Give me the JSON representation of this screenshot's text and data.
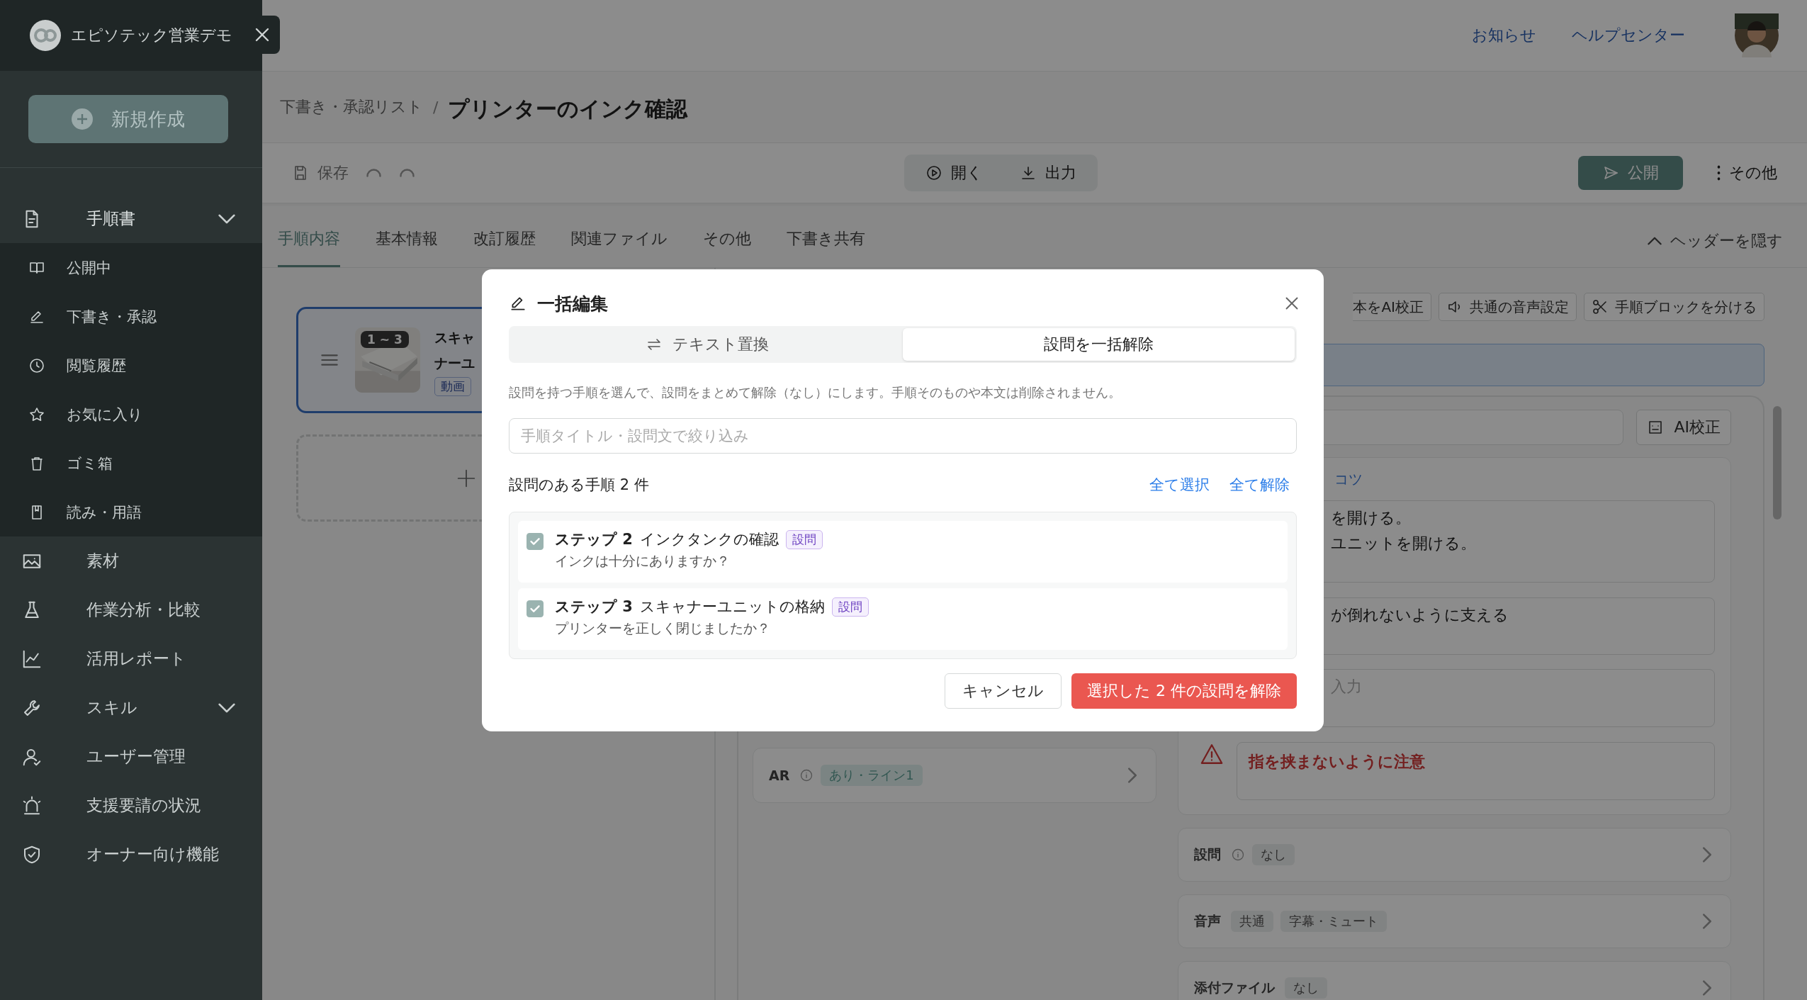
{
  "sidebar": {
    "workspace": "エピソテック営業デモ",
    "new_button": "新規作成",
    "items": [
      {
        "label": "手順書",
        "expanded": true,
        "children": [
          {
            "label": "公開中"
          },
          {
            "label": "下書き・承認"
          },
          {
            "label": "閲覧履歴"
          },
          {
            "label": "お気に入り"
          },
          {
            "label": "ゴミ箱"
          },
          {
            "label": "読み・用語"
          }
        ]
      },
      {
        "label": "素材"
      },
      {
        "label": "作業分析・比較"
      },
      {
        "label": "活用レポート"
      },
      {
        "label": "スキル",
        "expanded": false
      },
      {
        "label": "ユーザー管理"
      },
      {
        "label": "支援要請の状況"
      },
      {
        "label": "オーナー向け機能"
      }
    ]
  },
  "header": {
    "links": [
      "お知らせ",
      "ヘルプセンター"
    ]
  },
  "breadcrumb": {
    "parent": "下書き・承認リスト",
    "separator": "/",
    "current": "プリンターのインク確認"
  },
  "toolbar": {
    "save": "保存",
    "open": "開く",
    "export": "出力",
    "publish": "公開",
    "more": "その他"
  },
  "tabs": [
    {
      "label": "手順内容",
      "selected": true
    },
    {
      "label": "基本情報",
      "selected": false
    },
    {
      "label": "改訂履歴",
      "selected": false
    },
    {
      "label": "関連ファイル",
      "selected": false
    },
    {
      "label": "その他",
      "selected": false
    },
    {
      "label": "下書き共有",
      "selected": false
    }
  ],
  "hide_header": "ヘッダーを隠す",
  "step_card": {
    "range": "1 ~ 3",
    "title_lines": [
      "スキャ",
      "ナーユ"
    ],
    "tag": "動画",
    "selected": true
  },
  "editor": {
    "actions": [
      "本をAI校正",
      "共通の音声設定",
      "手順ブロックを分ける"
    ],
    "ai_button": "AI校正",
    "tips_label": "コツ",
    "text_blocks": [
      {
        "kind": "text",
        "lines": [
          "を開ける。",
          "ユニットを開ける。"
        ]
      },
      {
        "kind": "text",
        "lines": [
          "が倒れないように支える"
        ]
      },
      {
        "kind": "placeholder",
        "lines": [
          "入力"
        ]
      }
    ],
    "warning": "指を挟まないように注意",
    "ar": {
      "label": "AR",
      "value": "あり・ライン1"
    },
    "settings": [
      {
        "label": "設問",
        "info": true,
        "tags": [
          "なし"
        ]
      },
      {
        "label": "音声",
        "info": false,
        "tags": [
          "共通",
          "字幕・ミュート"
        ]
      },
      {
        "label": "添付ファイル",
        "info": false,
        "tags": [
          "なし"
        ]
      }
    ]
  },
  "dialog": {
    "title": "一括編集",
    "modes": [
      {
        "label": "テキスト置換",
        "selected": false
      },
      {
        "label": "設問を一括解除",
        "selected": true
      }
    ],
    "description": "設問を持つ手順を選んで、設問をまとめて解除（なし）にします。手順そのものや本文は削除されません。",
    "search": {
      "placeholder": "手順タイトル・設問文で絞り込み"
    },
    "count": "設問のある手順 2 件",
    "select_all": "全て選択",
    "deselect_all": "全て解除",
    "items": [
      {
        "step": "ステップ 2",
        "title": "インクタンクの確認",
        "tag": "設問",
        "question": "インクは十分にありますか？",
        "checked": true
      },
      {
        "step": "ステップ 3",
        "title": "スキャナーユニットの格納",
        "tag": "設問",
        "question": "プリンターを正しく閉じましたか？",
        "checked": true
      }
    ],
    "cancel": "キャンセル",
    "confirm": "選択した 2 件の設問を解除"
  }
}
